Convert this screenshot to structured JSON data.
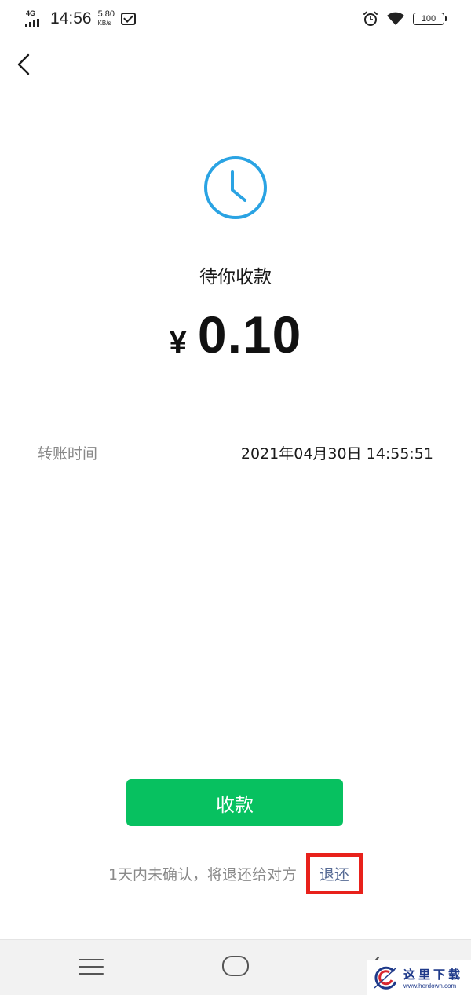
{
  "status_bar": {
    "network": "4G",
    "time": "14:56",
    "speed_value": "5.80",
    "speed_unit": "KB/s",
    "battery": "100",
    "icons": [
      "signal-icon",
      "mail-icon",
      "alarm-icon",
      "wifi-icon",
      "battery-icon"
    ]
  },
  "header": {
    "back_icon": "chevron-left-icon"
  },
  "payment": {
    "status_icon": "clock-icon",
    "status_text": "待你收款",
    "currency": "¥",
    "amount": "0.10"
  },
  "details": {
    "transfer_time_label": "转账时间",
    "transfer_time_value": "2021年04月30日 14:55:51"
  },
  "actions": {
    "receive_label": "收款",
    "refund_note": "1天内未确认，将退还给对方",
    "refund_link": "退还"
  },
  "nav_bar": {
    "icons": [
      "menu-icon",
      "home-icon",
      "back-icon"
    ]
  },
  "watermark": {
    "cn": "这里下载",
    "en": "www.herdown.com"
  },
  "colors": {
    "accent_green": "#07c160",
    "link_blue": "#576b95",
    "clock_blue": "#2aa3e3",
    "highlight_red": "#e8211b"
  }
}
